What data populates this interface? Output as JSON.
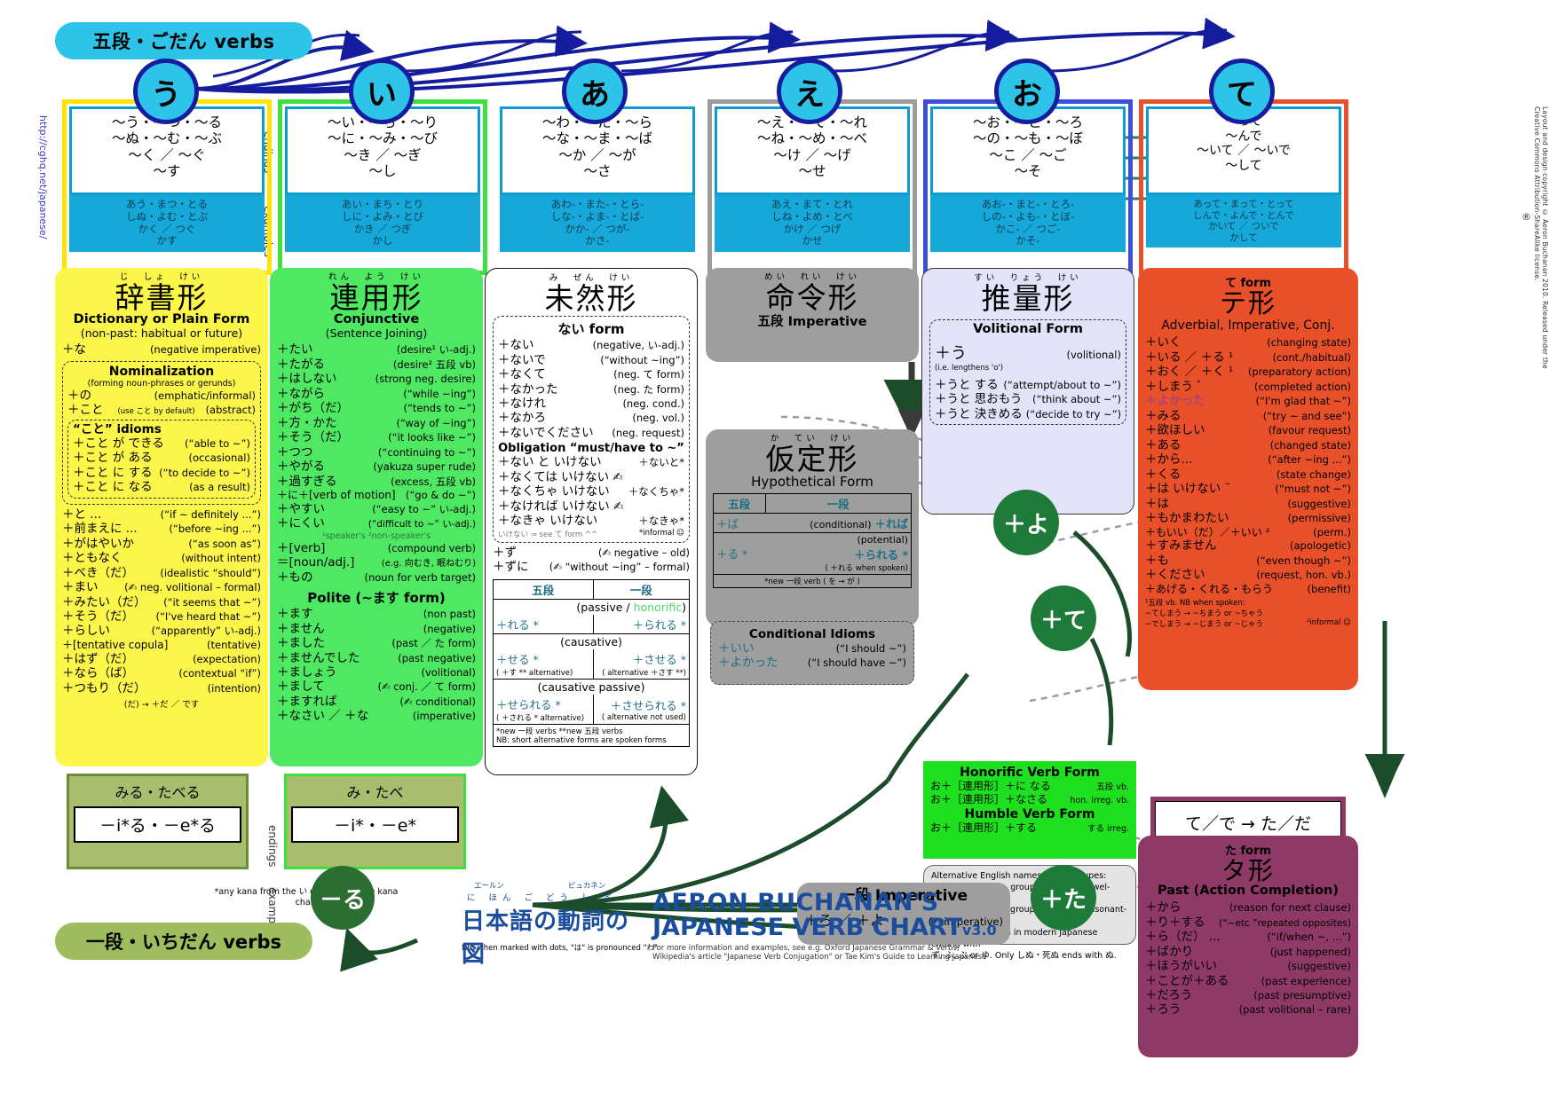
{
  "meta": {
    "url_side": "http://cghq.net/japanese/",
    "credit_side": "Layout and design  copyright © Aeron Buchanan 2010. Released under the Creative Commons Attribution-ShareAlike license.",
    "godan_pill": "五段・ごだん  verbs",
    "ichidan_pill": "一段・いちだん  verbs",
    "side_endings": "endings",
    "side_examples": "examples",
    "footnote_ha": "NB: when marked with dots, \"は\" is pronounced \"わ\"",
    "footnote_kana": "*any kana from the い or え line of the kana chart"
  },
  "title_block": {
    "ruby1": "エールン",
    "ruby2": "ビュカネン",
    "line1": "AERON BUCHANAN'S",
    "line2": "JAPANESE VERB CHART",
    "version": "v3.0",
    "jp_ruby": "に ほん ご    どう し     ず",
    "jp": "日本語の動詞の図",
    "credit1": "For more information and examples, see e.g. Oxford Japanese Grammar & Verbs,",
    "credit2": "Wikipedia's article \"Japanese Verb Conjugation\" or Tae Kim's Guide to Learning Japanese"
  },
  "columns": [
    {
      "kana": "う",
      "border": "#ffe400",
      "endings": "～う・～つ・～る\n～ぬ・～む・～ぶ\n～く ／ ～ぐ\n～す",
      "examples": "あう・まつ・とる\nしぬ・よむ・とぶ\nかく ／ つぐ\nかす"
    },
    {
      "kana": "い",
      "border": "#3ee03e",
      "endings": "～い・～ち・～り\n～に・～み・～び\n～き ／ ～ぎ\n～し",
      "examples": "あい・まち・とり\nしに・よみ・とび\nかき ／ つぎ\nかし"
    },
    {
      "kana": "あ",
      "border": "#ffffff",
      "endings": "～わ・～た・～ら\n～な・～ま・～ば\n～か ／ ～が\n～さ",
      "examples": "あわ-・また-・とら-\nしな-・よま-・とば-\nかか- ／ つが-\nかさ-"
    },
    {
      "kana": "え",
      "border": "#9c9c9c",
      "endings": "～え・～て・～れ\n～ね・～め・～べ\n～け ／ ～げ\n～せ",
      "examples": "あえ・まて・とれ\nしね・よめ・とべ\nかけ ／ つげ\nかせ"
    },
    {
      "kana": "お",
      "border": "#3b4fd8",
      "endings": "～お・～と・～ろ\n～の・～も・～ぼ\n～こ ／ ～ご\n～そ",
      "examples": "あお-・まと-・とろ-\nしの-・よも-・とぼ-\nかこ- ／ つご-\nかそ-"
    },
    {
      "kana": "て",
      "border": "#e8502a",
      "endings": "～って\n～んで\n～いて ／ ～いで\n～して",
      "examples": "あって・まって・とって\nしんで・よんで・とんで\nかいて ／ ついで\nかして"
    }
  ],
  "dictionary": {
    "ruby": "じ　しょ　けい",
    "jp": "辞書形",
    "en": "Dictionary or Plain Form",
    "sub": "(non-past: habitual or future)",
    "first": {
      "l": "＋な",
      "r": "(negative imperative)"
    },
    "nominalization": {
      "title": "Nominalization",
      "sub": "(forming noun-phrases or gerunds)",
      "rows": [
        {
          "l": "＋の",
          "m": "",
          "r": "(emphatic/informal)"
        },
        {
          "l": "＋こと",
          "m": "(use こと by default)",
          "r": "(abstract)"
        }
      ],
      "idioms_title": "“こと” idioms",
      "idioms": [
        {
          "l": "＋こと が できる",
          "r": "(“able to ~”)"
        },
        {
          "l": "＋こと が ある",
          "r": "(occasional)"
        },
        {
          "l": "＋こと に する",
          "r": "(“to decide to ~”)"
        },
        {
          "l": "＋こと に なる",
          "r": "(as a result)"
        }
      ]
    },
    "rows": [
      {
        "l": "＋と ...",
        "r": "(“if ~ definitely ...”)"
      },
      {
        "l": "＋前まえに ...",
        "r": "(“before ~ing ...”)"
      },
      {
        "l": "＋がはやいか",
        "r": "(“as soon as”)"
      },
      {
        "l": "＋ともなく",
        "r": "(without intent)"
      },
      {
        "l": "＋べき（だ）",
        "r": "(idealistic “should”)"
      },
      {
        "l": "＋まい",
        "r": "(✍ neg. volitional – formal)"
      },
      {
        "l": "＋みたい（だ）",
        "r": "(“it seems that ~”)"
      },
      {
        "l": "＋そう（だ）",
        "r": "(“I've heard that ~”)"
      },
      {
        "l": "＋らしい",
        "r": "(“apparently” い-adj.)"
      },
      {
        "l": "＋[tentative copula]",
        "r": "(tentative)"
      },
      {
        "l": "＋はず（だ）",
        "r": "(expectation)"
      },
      {
        "l": "＋なら（ば）",
        "r": "(contextual “if”)"
      },
      {
        "l": "＋つもり（だ）",
        "r": "(intention)"
      }
    ],
    "footer": "(だ) → ＋だ ／ です"
  },
  "conjunctive": {
    "ruby": "れん　よう　けい",
    "jp": "連用形",
    "en": "Conjunctive",
    "sub": "(Sentence Joining)",
    "rows": [
      {
        "l": "＋たい",
        "r": "(desire¹ い-adj.)"
      },
      {
        "l": "＋たがる",
        "r": "(desire² 五段 vb)"
      },
      {
        "l": "＋はしない",
        "r": "(strong neg. desire)"
      },
      {
        "l": "＋ながら",
        "r": "(“while ~ing”)"
      },
      {
        "l": "＋がち（だ）",
        "r": "(“tends to ~”)"
      },
      {
        "l": "＋方・かた",
        "r": "(“way of ~ing”)"
      },
      {
        "l": "＋そう（だ）",
        "r": "(“it looks like ~”)"
      },
      {
        "l": "＋つつ",
        "r": "(“continuing to ~”)"
      },
      {
        "l": "＋やがる",
        "r": "(yakuza super rude)"
      },
      {
        "l": "＋過すぎる",
        "r": "(excess, 五段 vb)"
      },
      {
        "l": "＋に＋[verb of motion]",
        "r": "(“go & do ~”)"
      },
      {
        "l": "＋やすい",
        "r": "(“easy to ~” い-adj.)"
      },
      {
        "l": "＋にくい",
        "r": "(“difficult to ~” い-adj.)"
      }
    ],
    "note": "¹speaker's  ²non-speaker's",
    "rows2": [
      {
        "l": "＋[verb]",
        "r": "(compound verb)"
      },
      {
        "l": "＝[noun/adj.]",
        "r": "(e.g. 向むき, 眠ねむり)"
      },
      {
        "l": "＋もの",
        "r": "(noun for verb target)"
      }
    ],
    "polite_title": "Polite (~ます form)",
    "polite": [
      {
        "l": "＋ます",
        "r": "(non past)"
      },
      {
        "l": "＋ません",
        "r": "(negative)"
      },
      {
        "l": "＋ました",
        "r": "(past ／ た form)"
      },
      {
        "l": "＋ませんでした",
        "r": "(past negative)"
      },
      {
        "l": "＋ましょう",
        "r": "(volitional)"
      },
      {
        "l": "＋まして",
        "r": "(✍ conj. ／ て form)"
      },
      {
        "l": "＋ますれば",
        "r": "(✍ conditional)"
      },
      {
        "l": "＋なさい ／ ＋な",
        "r": "(imperative)"
      }
    ]
  },
  "mizen": {
    "ruby": "み　ぜん　けい",
    "jp": "未然形",
    "nai_title": "ない  form",
    "nai": [
      {
        "l": "＋ない",
        "r": "(negative, い-adj.)"
      },
      {
        "l": "＋ないで",
        "r": "(“without ~ing”)"
      },
      {
        "l": "＋なくて",
        "r": "(neg. て form)"
      },
      {
        "l": "＋なかった",
        "r": "(neg. た form)"
      },
      {
        "l": "＋なけれ",
        "r": "(neg. cond.)"
      },
      {
        "l": "＋なかろ",
        "r": "(neg. vol.)"
      },
      {
        "l": "＋ないでください",
        "r": "(neg. request)"
      }
    ],
    "obligation_title": "Obligation “must/have to ~”",
    "obligation": [
      {
        "l": "＋ない と いけない",
        "r": "＋ないと*"
      },
      {
        "l": "＋なくては いけない ✍",
        "r": ""
      },
      {
        "l": "＋なくちゃ いけない",
        "r": "＋なくちゃ*"
      },
      {
        "l": "＋なければ いけない ✍",
        "r": ""
      },
      {
        "l": "＋なきゃ    いけない",
        "r": "＋なきゃ*"
      }
    ],
    "obl_note": "いけない ⇒ see  て  form ^^",
    "obl_informal": "*informal ☺",
    "zu": [
      {
        "l": "＋ず",
        "r": "(✍ negative – old)"
      },
      {
        "l": "＋ずに",
        "r": "(✍ “without ~ing” – formal)"
      }
    ],
    "table": {
      "head": [
        "五段",
        "一段"
      ],
      "rows": [
        {
          "label": "(passive / honorific)",
          "godan": "＋れる *",
          "ichidan": "＋られる *"
        },
        {
          "label": "(causative)",
          "godan": "＋せる *",
          "ichidan": "＋させる *",
          "gsub": "( ＋す ** alternative)",
          "isub": "( alternative ＋さす **)"
        },
        {
          "label": "(causative passive)",
          "godan": "＋せられる *",
          "ichidan": "＋させられる *",
          "gsub": "( ＋される * alternative)",
          "isub": "( alternative not used)"
        }
      ],
      "foot1": "*new 一段 verbs      **new 五段 verbs",
      "foot2": "NB: short alternative forms are spoken forms"
    }
  },
  "imperative": {
    "ruby": "めい　れい　けい",
    "jp": "命令形",
    "en": "五段 Imperative"
  },
  "hypothetical": {
    "ruby": "か　てい　けい",
    "jp": "仮定形",
    "en": "Hypothetical Form",
    "table": {
      "head": [
        "五段",
        "一段"
      ],
      "rows": [
        {
          "label": "(conditional)",
          "godan": "＋ば",
          "ichidan": "＋れば"
        },
        {
          "label": "(potential)",
          "godan": "＋る *",
          "ichidan": "＋られる *",
          "isub": "( ＋れる when spoken)"
        }
      ],
      "foot": "*new 一段 verb ( を → が )"
    },
    "idioms_title": "Conditional Idioms",
    "idioms": [
      {
        "l": "＋いい",
        "r": "(“I should ~”)"
      },
      {
        "l": "＋よかった",
        "r": "(“I should have ~”)"
      }
    ]
  },
  "volitional": {
    "ruby": "すい　りょう　けい",
    "jp": "推量形",
    "en": "Volitional Form",
    "main": {
      "l": "＋う",
      "r": "(volitional)"
    },
    "note": "(i.e. lengthens 'o')",
    "rows": [
      {
        "l": "＋うと する",
        "r": "(“attempt/about to ~”)"
      },
      {
        "l": "＋うと 思おもう",
        "r": "(“think about ~”)"
      },
      {
        "l": "＋うと 決きめる",
        "r": "(“decide to try ~”)"
      }
    ]
  },
  "teform": {
    "small": "て form",
    "jp": "テ形",
    "en": "Adverbial, Imperative, Conj.",
    "rows": [
      {
        "l": "＋いく",
        "r": "(changing state)"
      },
      {
        "l": "＋いる ／ ＋る ¹",
        "r": "(cont./habitual)"
      },
      {
        "l": "＋おく ／ ＋く ¹",
        "r": "(preparatory action)"
      },
      {
        "l": "＋しまう ゛",
        "r": "(completed action)"
      },
      {
        "l": "＋よかった",
        "r": "(“I'm glad that ~”)"
      },
      {
        "l": "＋みる",
        "r": "(“try ~ and see”)"
      },
      {
        "l": "＋欲ほしい",
        "r": "(favour request)"
      },
      {
        "l": "＋ある",
        "r": "(changed state)"
      },
      {
        "l": "＋から...",
        "r": "(“after ~ing ...”)"
      },
      {
        "l": "＋くる",
        "r": "(state change)"
      },
      {
        "l": "＋は いけない ¨",
        "r": "(“must not ~”)"
      },
      {
        "l": "＋は",
        "r": "(suggestive)"
      },
      {
        "l": "＋もかまわたい",
        "r": "(permissive)"
      },
      {
        "l": "＋もいい（だ）／＋いい ²",
        "r": "(perm.)"
      },
      {
        "l": "＋すみません",
        "r": "(apologetic)"
      },
      {
        "l": "＋も",
        "r": "(“even though ~”)"
      },
      {
        "l": "＋ください",
        "r": "(request, hon. vb.)"
      },
      {
        "l": "＋あげる・くれる・もらう",
        "r": "(benefit)"
      }
    ],
    "foot1": "¹五段 vb. NB when spoken:",
    "foot2": "~てしまう → ~ちまう or ~ちゃう",
    "foot3": "~でしまう → ~じまう or ~じゃう",
    "foot4": "²informal ☺",
    "arrow_box": "て／で → た／だ"
  },
  "past": {
    "ruby": "た  form",
    "jp": "タ形",
    "en": "Past  (Action Completion)",
    "rows": [
      {
        "l": "＋から",
        "r": "(reason for next clause)"
      },
      {
        "l": "＋り＋する",
        "r": "(“~etc ”repeated opposites)"
      },
      {
        "l": "＋ら（だ） ...",
        "r": "(“if/when ~, ...”)"
      },
      {
        "l": "＋ばかり",
        "r": "(just happened)"
      },
      {
        "l": "＋ほうがいい",
        "r": "(suggestive)"
      },
      {
        "l": "＋ことが＋ある",
        "r": "(past experience)"
      },
      {
        "l": "＋だろう",
        "r": "(past presumptive)"
      },
      {
        "l": "＋ろう",
        "r": "(past volitional – rare)"
      }
    ]
  },
  "honorific": {
    "title1": "Honorific Verb Form",
    "rows1": [
      {
        "l": "お＋［連用形］＋に なる",
        "r": "五段 vb."
      },
      {
        "l": "お＋［連用形］＋なさる",
        "r": "hon. irreg. vb."
      }
    ],
    "title2": "Humble Verb Form",
    "rows2": [
      {
        "l": "お＋［連用形］＋する",
        "r": "する irreg."
      }
    ]
  },
  "altnames": {
    "line1": "Alternative English names for verb types:",
    "line2": "一段 vbs: one-row, group II, type ②, vowel-stem",
    "line3": "五段 vbs: five-row, group I, type ①, consonant-stem",
    "line4": "There are no verbs in modern Japanese ending with",
    "line5": "ず, ふ, ぶ or ゆ. Only しぬ・死ぬ ends with ぬ."
  },
  "ichidan_imperative": {
    "title": "一段  Imperative",
    "row": {
      "l": "＋ろ ／ ＋よ",
      "r": "(✍ imperative)"
    }
  },
  "stem_boxes": {
    "godan": {
      "examples": "みる・たべる",
      "stem": "－i*る・－e*る"
    },
    "ichidan": {
      "examples": "み・たべ",
      "stem": "－i*・－e*"
    }
  },
  "operators": {
    "yo": "＋よ",
    "te": "＋て",
    "ta": "＋た",
    "ru": "－る"
  }
}
